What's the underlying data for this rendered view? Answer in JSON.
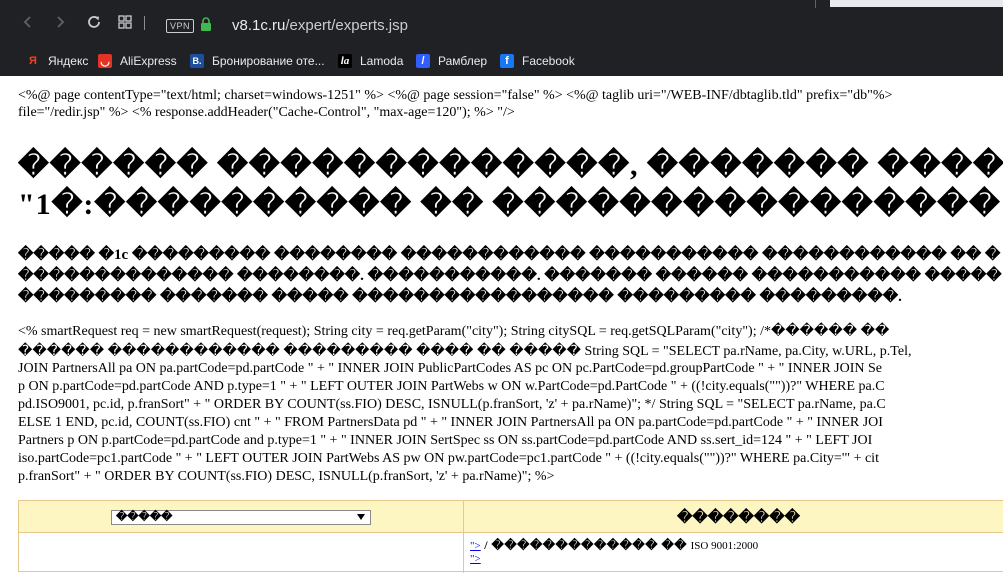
{
  "browser": {
    "url_host": "v8.1c.ru",
    "url_path": "/expert/experts.jsp",
    "vpn_label": "VPN",
    "bookmarks": [
      {
        "label": "Яндекс",
        "icon": "yandex-icon",
        "icon_glyph": "Я",
        "color": "#fc3f1d"
      },
      {
        "label": "AliExpress",
        "icon": "aliexpress-icon",
        "icon_glyph": "◡",
        "color": "#e43225"
      },
      {
        "label": "Бронирование оте...",
        "icon": "booking-icon",
        "icon_glyph": "B.",
        "color": "#1e4f9f"
      },
      {
        "label": "Lamoda",
        "icon": "lamoda-icon",
        "icon_glyph": "la",
        "color": "#000000"
      },
      {
        "label": "Рамблер",
        "icon": "rambler-icon",
        "icon_glyph": "/",
        "color": "#315efb"
      },
      {
        "label": "Facebook",
        "icon": "facebook-icon",
        "icon_glyph": "f",
        "color": "#1877f2"
      }
    ]
  },
  "page": {
    "jsp_lines": [
      "<%@ page contentType=\"text/html; charset=windows-1251\" %> <%@ page session=\"false\" %> <%@ taglib uri=\"/WEB-INF/dbtaglib.tld\" prefix=\"db\"%>",
      "file=\"/redir.jsp\" %> <% response.addHeader(\"Cache-Control\", \"max-age=120\"); %> \"/>"
    ],
    "heading_lines": [
      "������ �������������, ������� �������",
      "\"1�:���������� �� ���������������� ���"
    ],
    "intro_lines": [
      "����� �1с ��������� �������� ������������ ����������� ������������ �� �",
      "�������������� ��������. �����������. ������� ������ ����������� �����",
      "��������� ������� ����� ����������������� ��������� ���������."
    ],
    "sql_lines": [
      "<% smartRequest req = new smartRequest(request); String city = req.getParam(\"city\"); String citySQL = req.getSQLParam(\"city\"); /*������ ��",
      "������ ������������ ��������� ���� �� ����� String SQL = \"SELECT pa.rName, pa.City, w.URL, p.Tel,",
      "JOIN PartnersAll pa ON pa.partCode=pd.partCode \" + \" INNER JOIN PublicPartCodes AS pc ON pc.PartCode=pd.groupPartCode \" + \" INNER JOIN Se",
      "p ON p.partCode=pd.partCode AND p.type=1 \" + \" LEFT OUTER JOIN PartWebs w ON w.PartCode=pd.PartCode \" + ((!city.equals(\"\"))?\" WHERE pa.C",
      "pd.ISO9001, pc.id, p.franSort\" + \" ORDER BY COUNT(ss.FIO) DESC, ISNULL(p.franSort, 'z' + pa.rName)\"; */ String SQL = \"SELECT pa.rName, pa.C",
      "ELSE 1 END, pc.id, COUNT(ss.FIO) cnt \" + \" FROM PartnersData pd \" + \" INNER JOIN PartnersAll pa ON pa.partCode=pd.partCode \" + \" INNER JOI",
      "Partners p ON p.partCode=pd.partCode and p.type=1 \" + \" INNER JOIN SertSpec ss ON ss.partCode=pd.partCode AND ss.sert_id=124 \" + \" LEFT JOI",
      "iso.partCode=pc1.partCode \" + \" LEFT OUTER JOIN PartWebs AS pw ON pw.partCode=pc1.partCode \" + ((!city.equals(\"\"))?\" WHERE pa.City='\" + cit",
      "p.franSort\" + \" ORDER BY COUNT(ss.FIO) DESC, ISNULL(p.franSort, 'z' + pa.rName)\"; %>"
    ],
    "table": {
      "select_value": "�����",
      "header_right": "��������",
      "row_link_1": "\">",
      "row_text": " / ������������� �� ",
      "row_iso": "ISO 9001:2000",
      "row_link_2": "\">"
    }
  }
}
